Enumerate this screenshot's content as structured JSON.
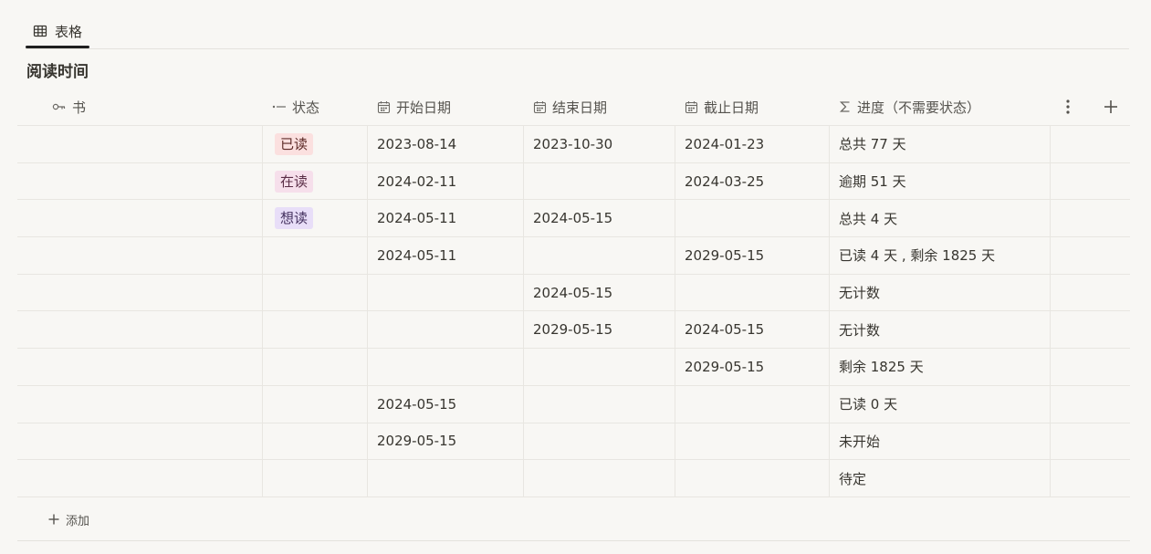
{
  "tabs": [
    {
      "label": "表格",
      "icon": "table-icon"
    }
  ],
  "table_title": "阅读时间",
  "columns": [
    {
      "label": "书",
      "icon": "key-icon"
    },
    {
      "label": "状态",
      "icon": "status-icon"
    },
    {
      "label": "开始日期",
      "icon": "calendar-icon"
    },
    {
      "label": "结束日期",
      "icon": "calendar-icon"
    },
    {
      "label": "截止日期",
      "icon": "calendar-icon"
    },
    {
      "label": "进度（不需要状态）",
      "icon": "sigma-icon"
    }
  ],
  "header_actions": {
    "more_icon": "more-vertical-icon",
    "add_icon": "plus-icon"
  },
  "status_colors": {
    "已读": {
      "bg": "#fbe0df",
      "fg": "#5d2a27"
    },
    "在读": {
      "bg": "#f6dfeb",
      "fg": "#5a2d46"
    },
    "想读": {
      "bg": "#e8def8",
      "fg": "#43305e"
    }
  },
  "rows": [
    {
      "book": "",
      "status": "已读",
      "start": "2023-08-14",
      "end": "2023-10-30",
      "deadline": "2024-01-23",
      "progress": "总共 77 天"
    },
    {
      "book": "",
      "status": "在读",
      "start": "2024-02-11",
      "end": "",
      "deadline": "2024-03-25",
      "progress": "逾期 51 天"
    },
    {
      "book": "",
      "status": "想读",
      "start": "2024-05-11",
      "end": "2024-05-15",
      "deadline": "",
      "progress": "总共 4 天"
    },
    {
      "book": "",
      "status": "",
      "start": "2024-05-11",
      "end": "",
      "deadline": "2029-05-15",
      "progress": "已读 4 天 , 剩余 1825 天"
    },
    {
      "book": "",
      "status": "",
      "start": "",
      "end": "2024-05-15",
      "deadline": "",
      "progress": "无计数"
    },
    {
      "book": "",
      "status": "",
      "start": "",
      "end": "2029-05-15",
      "deadline": "2024-05-15",
      "progress": "无计数"
    },
    {
      "book": "",
      "status": "",
      "start": "",
      "end": "",
      "deadline": "2029-05-15",
      "progress": "剩余 1825 天"
    },
    {
      "book": "",
      "status": "",
      "start": "2024-05-15",
      "end": "",
      "deadline": "",
      "progress": "已读 0 天"
    },
    {
      "book": "",
      "status": "",
      "start": "2029-05-15",
      "end": "",
      "deadline": "",
      "progress": "未开始"
    },
    {
      "book": "",
      "status": "",
      "start": "",
      "end": "",
      "deadline": "",
      "progress": "待定"
    }
  ],
  "add_row_label": "添加"
}
